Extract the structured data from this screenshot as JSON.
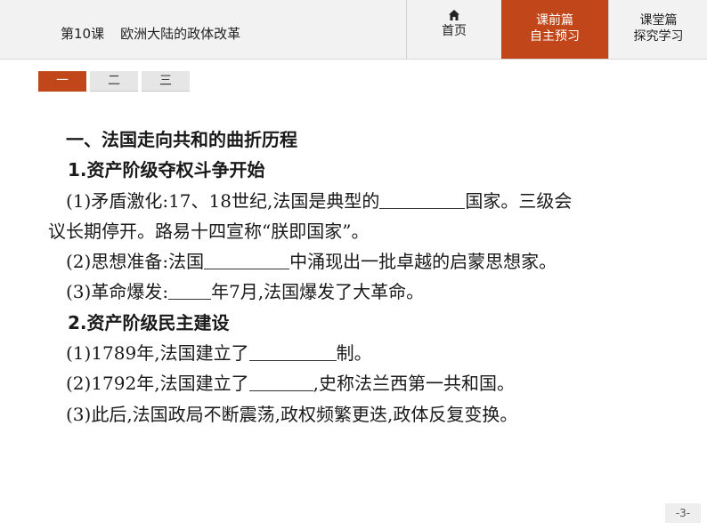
{
  "header": {
    "lesson_no": "第10课",
    "lesson_title": "欧洲大陆的政体改革",
    "nav": {
      "home": {
        "icon": "home-icon",
        "label": "首页"
      },
      "pre": {
        "line1": "课前篇",
        "line2": "自主预习"
      },
      "class": {
        "line1": "课堂篇",
        "line2": "探究学习"
      }
    },
    "accent_color": "#c1461a"
  },
  "tabs": [
    "一",
    "二",
    "三"
  ],
  "content": {
    "heading": "一、法国走向共和的曲折历程",
    "sec1_title": "1.资产阶级夺权斗争开始",
    "p1_a": "(1)矛盾激化:17、18世纪,法国是典型的",
    "p1_b": "国家。三级会",
    "p1_c": "议长期停开。路易十四宣称“朕即国家”。",
    "p2_a": "(2)思想准备:法国",
    "p2_b": "中涌现出一批卓越的启蒙思想家。",
    "p3_a": "(3)革命爆发:",
    "p3_b": "年7月,法国爆发了大革命。",
    "sec2_title": "2.资产阶级民主建设",
    "p4_a": "(1)1789年,法国建立了",
    "p4_b": "制。",
    "p5_a": "(2)1792年,法国建立了",
    "p5_b": ",史称法兰西第一共和国。",
    "p6": "(3)此后,法国政局不断震荡,政权频繁更迭,政体反复变换。"
  },
  "page_number": "-3-"
}
